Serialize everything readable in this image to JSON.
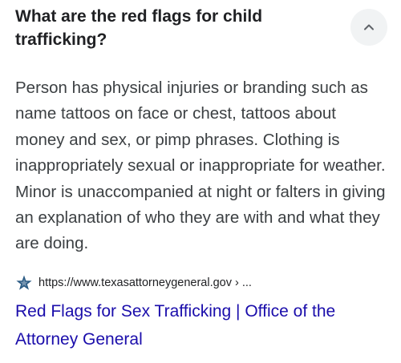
{
  "question": "What are the red flags for child trafficking?",
  "answer": "Person has physical injuries or branding such as name tattoos on face or chest, tattoos about money and sex, or pimp phrases. Clothing is inappropriately sexual or inappropriate for weather. Minor is unaccompanied at night or falters in giving an explanation of who they are with and what they are doing.",
  "source": {
    "favicon": "texas-star-icon",
    "url": "https://www.texasattorneygeneral.gov › ...",
    "title": "Red Flags for Sex Trafficking | Office of the Attorney General"
  },
  "toggle_icon": "chevron-up-icon",
  "colors": {
    "text": "#202124",
    "body_text": "#3c4043",
    "link": "#1a0dab",
    "button_bg": "#f1f3f4",
    "favicon": "#2b5b84"
  }
}
